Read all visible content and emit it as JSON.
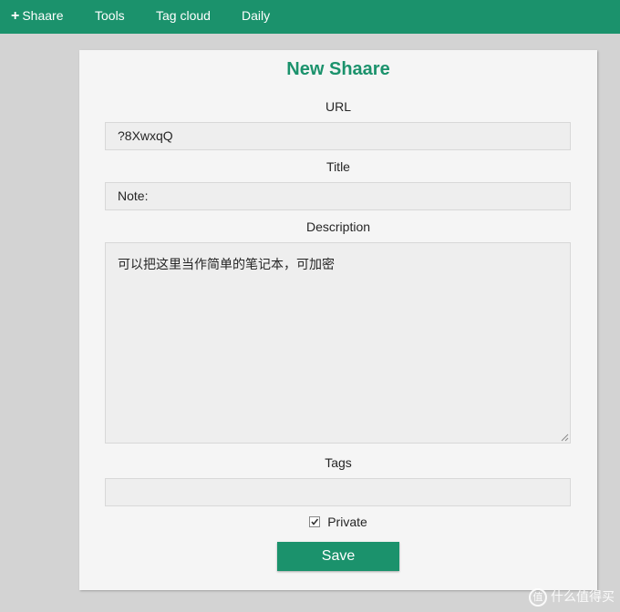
{
  "nav": {
    "shaare": {
      "icon": "plus-icon",
      "label": "Shaare"
    },
    "tools": "Tools",
    "tag_cloud": "Tag cloud",
    "daily": "Daily"
  },
  "form": {
    "title": "New Shaare",
    "url_label": "URL",
    "url_value": "?8XwxqQ",
    "title_label": "Title",
    "title_value": "Note:",
    "description_label": "Description",
    "description_value": "可以把这里当作简单的笔记本，可加密",
    "tags_label": "Tags",
    "tags_value": "",
    "private_label": "Private",
    "private_checked": true,
    "save_label": "Save"
  },
  "watermark": {
    "icon_glyph": "值",
    "text": "什么值得买"
  },
  "colors": {
    "accent": "#1b926c",
    "background": "#d3d3d3",
    "panel": "#f5f5f5",
    "field": "#eeeeee"
  }
}
